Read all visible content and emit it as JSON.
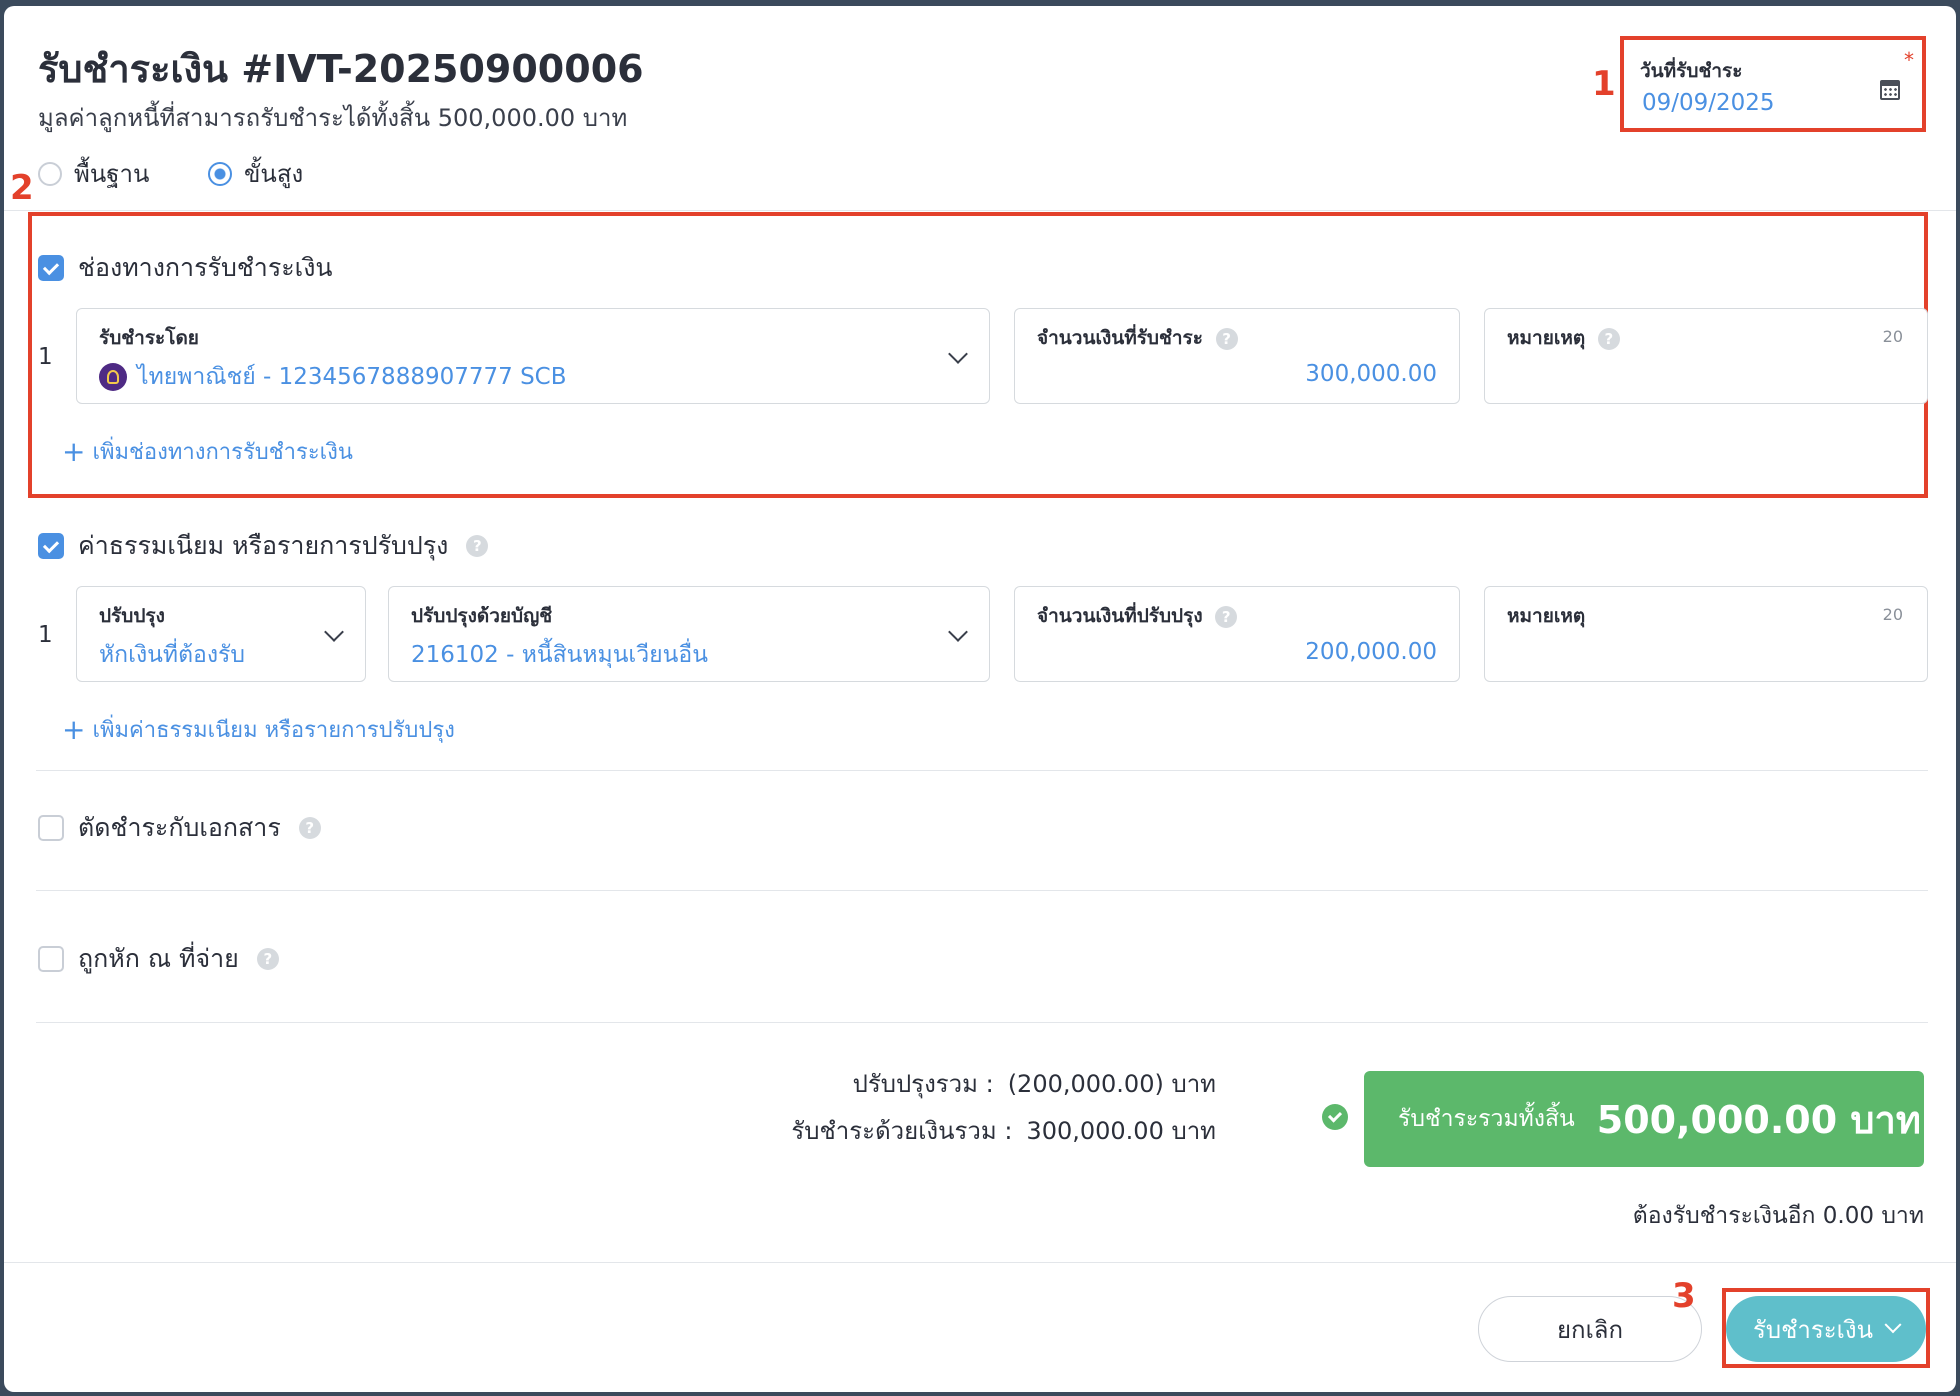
{
  "header": {
    "title": "รับชำระเงิน #IVT-20250900006",
    "subtitle": "มูลค่าลูกหนี้ที่สามารถรับชำระได้ทั้งสิ้น 500,000.00 บาท"
  },
  "mode": {
    "options": [
      "พื้นฐาน",
      "ขั้นสูง"
    ],
    "selected": "ขั้นสูง"
  },
  "payment_date": {
    "label": "วันที่รับชำระ",
    "value": "09/09/2025",
    "required_mark": "*"
  },
  "annotations": {
    "n1": "1",
    "n2": "2",
    "n3": "3"
  },
  "payment_channels": {
    "checked": true,
    "label": "ช่องทางการรับชำระเงิน",
    "rows": [
      {
        "index": "1",
        "method_label": "รับชำระโดย",
        "method_value": "ไทยพาณิชย์ - 1234567888907777 SCB",
        "amount_label": "จำนวนเงินที่รับชำระ",
        "amount_value": "300,000.00",
        "note_label": "หมายเหตุ",
        "note_count": "20"
      }
    ],
    "add_label": "เพิ่มช่องทางการรับชำระเงิน"
  },
  "fees": {
    "checked": true,
    "label": "ค่าธรรมเนียม หรือรายการปรับปรุง",
    "rows": [
      {
        "index": "1",
        "adjust_label": "ปรับปรุง",
        "adjust_value": "หักเงินที่ต้องรับ",
        "account_label": "ปรับปรุงด้วยบัญชี",
        "account_value": "216102 - หนี้สินหมุนเวียนอื่น",
        "amount_label": "จำนวนเงินที่ปรับปรุง",
        "amount_value": "200,000.00",
        "note_label": "หมายเหตุ",
        "note_count": "20"
      }
    ],
    "add_label": "เพิ่มค่าธรรมเนียม หรือรายการปรับปรุง"
  },
  "offset_docs": {
    "checked": false,
    "label": "ตัดชำระกับเอกสาร"
  },
  "withholding": {
    "checked": false,
    "label": "ถูกหัก ณ ที่จ่าย"
  },
  "summary": {
    "adjust_total_label": "ปรับปรุงรวม :",
    "adjust_total_value": "(200,000.00) บาท",
    "cash_total_label": "รับชำระด้วยเงินรวม :",
    "cash_total_value": "300,000.00 บาท",
    "grand_total_label": "รับชำระรวมทั้งสิ้น",
    "grand_total_value": "500,000.00 บาท",
    "remaining": "ต้องรับชำระเงินอีก 0.00 บาท"
  },
  "footer": {
    "cancel_label": "ยกเลิก",
    "submit_label": "รับชำระเงิน"
  },
  "colors": {
    "accent": "#4a90e2",
    "highlight_red": "#e3412b",
    "total_green": "#5cb86b",
    "submit_teal": "#5fbfcb"
  }
}
